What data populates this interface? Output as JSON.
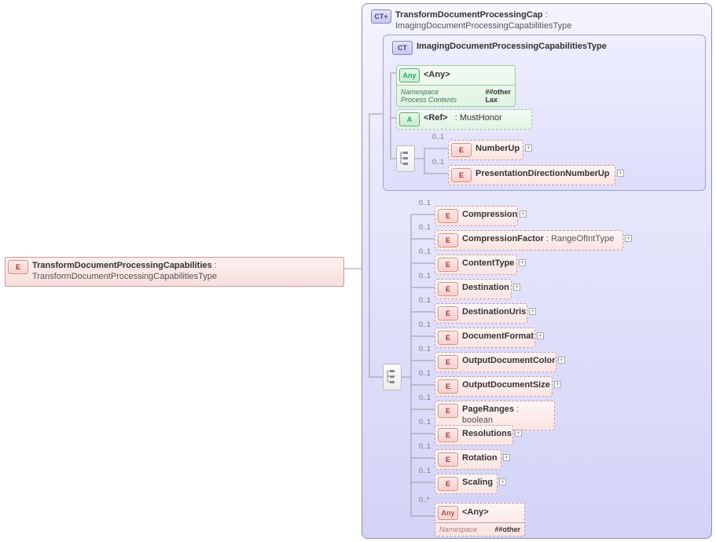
{
  "root": {
    "name": "TransformDocumentProcessingCapabilities",
    "type": "TransformDocumentProcessingCapabilitiesType"
  },
  "ct_outer": {
    "name": "TransformDocumentProcessingCap",
    "type": "ImagingDocumentProcessingCapabilitiesType"
  },
  "ct_inner": {
    "name": "ImagingDocumentProcessingCapabilitiesType"
  },
  "any_top": {
    "label": "<Any>",
    "ns_label": "Namespace",
    "ns_val": "##other",
    "pc_label": "Process Contents",
    "pc_val": "Lax"
  },
  "ref": {
    "label": "<Ref>",
    "sep": ":",
    "target": "MustHonor"
  },
  "inner_children": [
    {
      "label": "NumberUp",
      "card": "0..1"
    },
    {
      "label": "PresentationDirectionNumberUp",
      "card": "0..1"
    }
  ],
  "outer_children": [
    {
      "label": "Compression",
      "card": "0..1",
      "type": ""
    },
    {
      "label": "CompressionFactor",
      "card": "0..1",
      "type": "RangeOfIntType"
    },
    {
      "label": "ContentType",
      "card": "0..1",
      "type": ""
    },
    {
      "label": "Destination",
      "card": "0..1",
      "type": ""
    },
    {
      "label": "DestinationUris",
      "card": "0..1",
      "type": ""
    },
    {
      "label": "DocumentFormat",
      "card": "0..1",
      "type": ""
    },
    {
      "label": "OutputDocumentColor",
      "card": "0..1",
      "type": ""
    },
    {
      "label": "OutputDocumentSize",
      "card": "0..1",
      "type": ""
    },
    {
      "label": "PageRanges",
      "card": "0..1",
      "type": "boolean"
    },
    {
      "label": "Resolutions",
      "card": "0..1",
      "type": ""
    },
    {
      "label": "Rotation",
      "card": "0..1",
      "type": ""
    },
    {
      "label": "Scaling",
      "card": "0..1",
      "type": ""
    }
  ],
  "any_bottom": {
    "label": "<Any>",
    "card": "0..*",
    "ns_label": "Namespace",
    "ns_val": "##other"
  },
  "ui": {
    "colon": " : "
  }
}
